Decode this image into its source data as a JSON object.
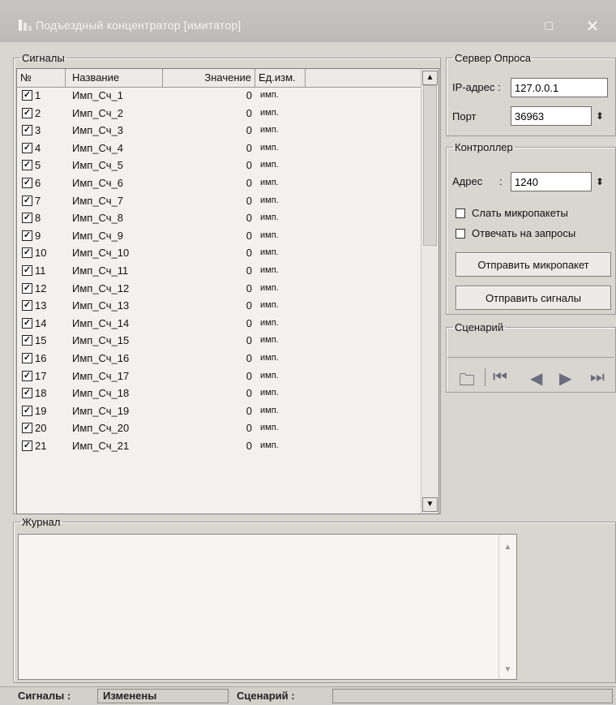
{
  "window": {
    "title": "Подъездный концентратор [имитатор]",
    "maximize_glyph": "□",
    "close_glyph": "✕",
    "app_icon": "app-grid-icon"
  },
  "signals": {
    "group_title": "Сигналы",
    "columns": {
      "num": "№",
      "name": "Название",
      "value": "Значение",
      "unit": "Ед.изм."
    },
    "rows": [
      {
        "checked": true,
        "num": "1",
        "name": "Имп_Сч_1",
        "value": "0",
        "unit": "имп."
      },
      {
        "checked": true,
        "num": "2",
        "name": "Имп_Сч_2",
        "value": "0",
        "unit": "имп."
      },
      {
        "checked": true,
        "num": "3",
        "name": "Имп_Сч_3",
        "value": "0",
        "unit": "имп."
      },
      {
        "checked": true,
        "num": "4",
        "name": "Имп_Сч_4",
        "value": "0",
        "unit": "имп."
      },
      {
        "checked": true,
        "num": "5",
        "name": "Имп_Сч_5",
        "value": "0",
        "unit": "имп."
      },
      {
        "checked": true,
        "num": "6",
        "name": "Имп_Сч_6",
        "value": "0",
        "unit": "имп."
      },
      {
        "checked": true,
        "num": "7",
        "name": "Имп_Сч_7",
        "value": "0",
        "unit": "имп."
      },
      {
        "checked": true,
        "num": "8",
        "name": "Имп_Сч_8",
        "value": "0",
        "unit": "имп."
      },
      {
        "checked": true,
        "num": "9",
        "name": "Имп_Сч_9",
        "value": "0",
        "unit": "имп."
      },
      {
        "checked": true,
        "num": "10",
        "name": "Имп_Сч_10",
        "value": "0",
        "unit": "имп."
      },
      {
        "checked": true,
        "num": "11",
        "name": "Имп_Сч_11",
        "value": "0",
        "unit": "имп."
      },
      {
        "checked": true,
        "num": "12",
        "name": "Имп_Сч_12",
        "value": "0",
        "unit": "имп."
      },
      {
        "checked": true,
        "num": "13",
        "name": "Имп_Сч_13",
        "value": "0",
        "unit": "имп."
      },
      {
        "checked": true,
        "num": "14",
        "name": "Имп_Сч_14",
        "value": "0",
        "unit": "имп."
      },
      {
        "checked": true,
        "num": "15",
        "name": "Имп_Сч_15",
        "value": "0",
        "unit": "имп."
      },
      {
        "checked": true,
        "num": "16",
        "name": "Имп_Сч_16",
        "value": "0",
        "unit": "имп."
      },
      {
        "checked": true,
        "num": "17",
        "name": "Имп_Сч_17",
        "value": "0",
        "unit": "имп."
      },
      {
        "checked": true,
        "num": "18",
        "name": "Имп_Сч_18",
        "value": "0",
        "unit": "имп."
      },
      {
        "checked": true,
        "num": "19",
        "name": "Имп_Сч_19",
        "value": "0",
        "unit": "имп."
      },
      {
        "checked": true,
        "num": "20",
        "name": "Имп_Сч_20",
        "value": "0",
        "unit": "имп."
      },
      {
        "checked": true,
        "num": "21",
        "name": "Имп_Сч_21",
        "value": "0",
        "unit": "имп."
      }
    ]
  },
  "server": {
    "group_title": "Сервер Опроса",
    "ip_label": "IP-адрес :",
    "ip_value": "127.0.0.1",
    "port_label": "Порт",
    "port_value": "36963"
  },
  "controller": {
    "group_title": "Контроллер",
    "address_label": "Адрес",
    "address_value": "1240",
    "send_micropackets_label": "Слать микропакеты",
    "send_micropackets_checked": false,
    "answer_requests_label": "Отвечать на запросы",
    "answer_requests_checked": false,
    "send_micropacket_button": "Отправить микропакет",
    "send_signals_button": "Отправить сигналы"
  },
  "scenario": {
    "group_title": "Сценарий",
    "icons": [
      "folder-open-icon",
      "skip-first-icon",
      "step-back-icon",
      "step-forward-icon",
      "skip-last-icon"
    ]
  },
  "journal": {
    "group_title": "Журнал",
    "text": ""
  },
  "statusbar": {
    "signals_label": "Сигналы :",
    "signals_value": "Изменены",
    "scenario_label": "Сценарий :",
    "scenario_value": ""
  }
}
